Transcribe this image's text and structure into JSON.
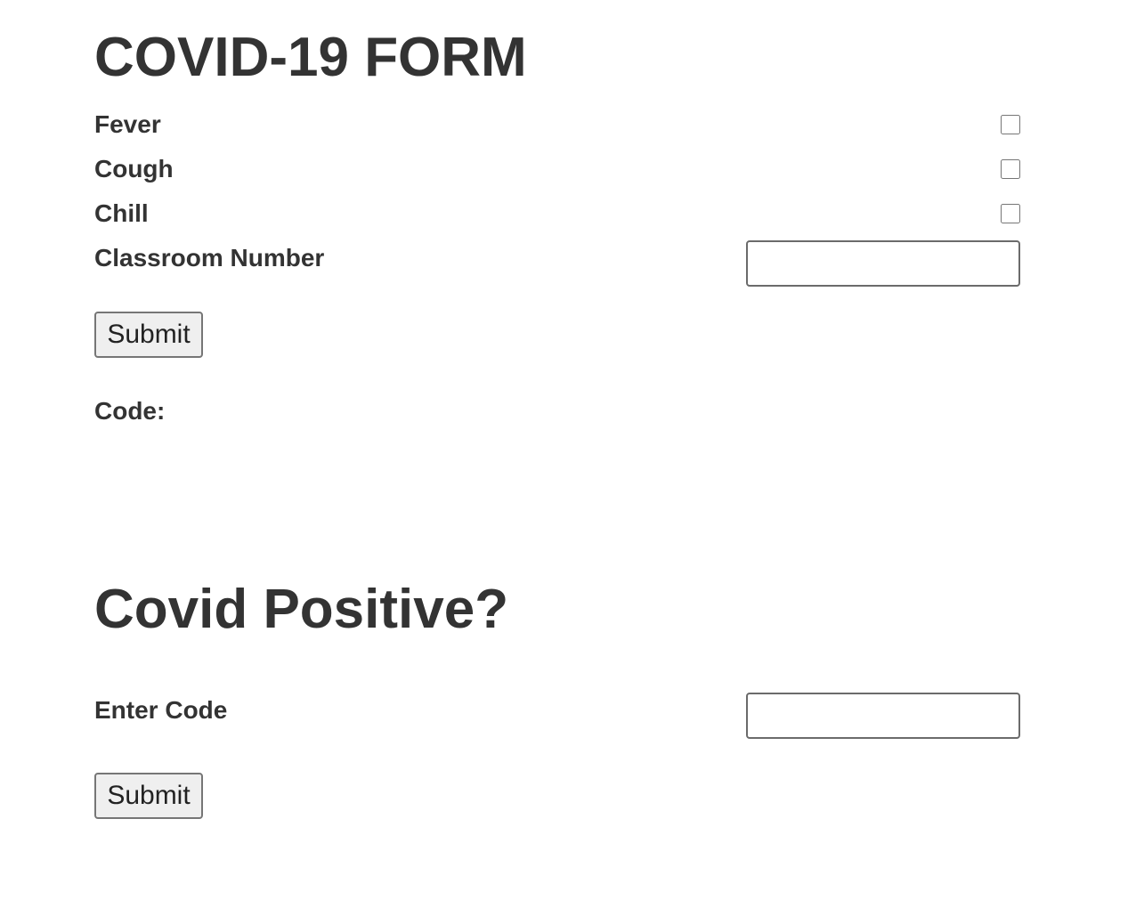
{
  "form": {
    "title": "COVID-19 FORM",
    "symptoms": [
      {
        "label": "Fever",
        "checked": false
      },
      {
        "label": "Cough",
        "checked": false
      },
      {
        "label": "Chill",
        "checked": false
      }
    ],
    "classroom_label": "Classroom Number",
    "classroom_value": "",
    "submit_label": "Submit",
    "code_label": "Code:"
  },
  "positive": {
    "title": "Covid Positive?",
    "enter_code_label": "Enter Code",
    "enter_code_value": "",
    "submit_label": "Submit"
  }
}
